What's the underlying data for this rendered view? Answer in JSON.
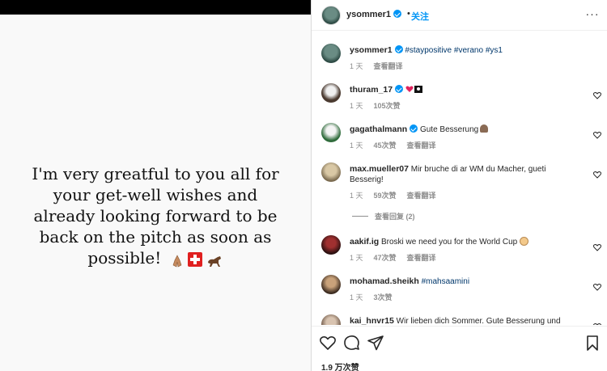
{
  "media": {
    "lines": [
      "I'm very greatful to you all for",
      "your get-well wishes and",
      "already looking forward to be",
      "back on the pitch as soon as",
      "possible!"
    ],
    "emojis": [
      "folded-hands",
      "swiss-flag",
      "horse"
    ]
  },
  "header": {
    "username": "ysommer1",
    "separator": "•",
    "follow_label": "关注",
    "more_label": "···"
  },
  "caption": {
    "username": "ysommer1",
    "hashtags": "#staypositive #verano #ys1",
    "time": "1 天",
    "translate": "查看翻译"
  },
  "comments": [
    {
      "username": "thuram_17",
      "text": "",
      "time": "1 天",
      "likes": "105次赞",
      "reply": "",
      "verified": true
    },
    {
      "username": "gagathalmann",
      "text": "Gute Besserung",
      "time": "1 天",
      "likes": "45次赞",
      "reply": "查看翻译",
      "verified": true
    },
    {
      "username": "max.mueller07",
      "text": "Mir bruche di ar WM du Macher, gueti Besserig!",
      "time": "1 天",
      "likes": "59次赞",
      "reply": "查看翻译",
      "verified": false,
      "view_replies": "查看回复 (2)"
    },
    {
      "username": "aakif.ig",
      "text": "Broski we need you for the World Cup",
      "time": "1 天",
      "likes": "47次赞",
      "reply": "查看翻译",
      "verified": false
    },
    {
      "username": "mohamad.sheikh",
      "text": "#mahsaamini",
      "time": "1 天",
      "likes": "3次赞",
      "reply": "",
      "verified": false
    },
    {
      "username": "kai_hnvr15",
      "text": "Wir lieben dich Sommer. Gute Besserung und",
      "time": "",
      "likes": "",
      "reply": "",
      "verified": false
    }
  ],
  "footer": {
    "likes": "1.9 万次赞"
  },
  "colors": {
    "accent": "#0095f6",
    "hashtag": "#00376b",
    "muted": "#8e8e8e"
  }
}
